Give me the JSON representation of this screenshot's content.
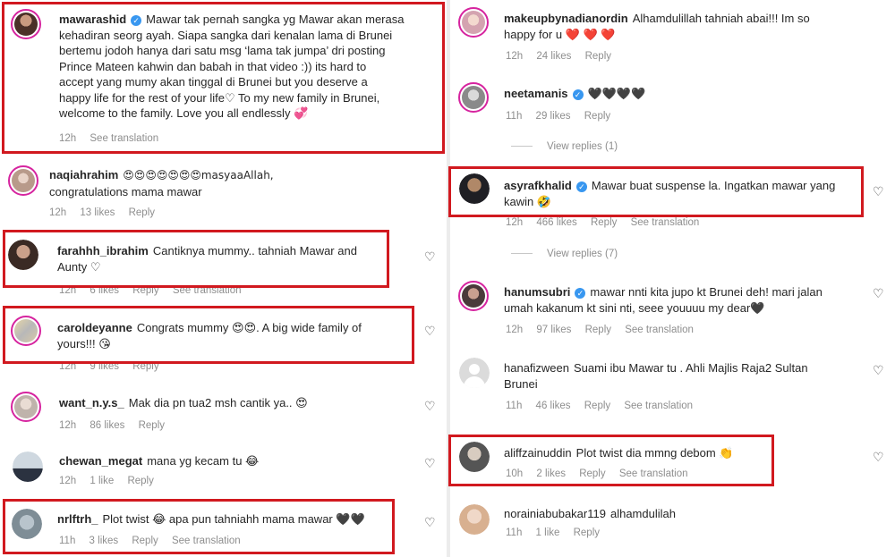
{
  "left": {
    "comments": [
      {
        "username": "mawarashid",
        "verified": true,
        "lines": [
          "Mawar tak pernah sangka yg Mawar akan merasa",
          "kehadiran seorg ayah. Siapa sangka dari kenalan lama di Brunei",
          "bertemu jodoh hanya dari satu msg ‘lama tak jumpa’ dri posting",
          "Prince Mateen kahwin dan babah in that video :)) its hard to",
          "accept yang mumy akan tinggal di Brunei but you deserve a",
          "happy life for the rest of your life♡  To my new family in Brunei,",
          "welcome to the family. Love you all endlessly 💞"
        ],
        "time": "12h",
        "likes": "",
        "reply": "",
        "translation": "See translation"
      },
      {
        "username": "naqiahrahim",
        "verified": false,
        "lines": [
          "😍😍😍😍😍😍😍masyaaAllah,",
          "congratulations mama mawar"
        ],
        "time": "12h",
        "likes": "13 likes",
        "reply": "Reply",
        "translation": ""
      },
      {
        "username": "farahhh_ibrahim",
        "verified": false,
        "lines": [
          "Cantiknya mummy.. tahniah Mawar and",
          "Aunty ♡"
        ],
        "time": "12h",
        "likes": "6 likes",
        "reply": "Reply",
        "translation": "See translation"
      },
      {
        "username": "caroldeyanne",
        "verified": false,
        "lines": [
          "Congrats mummy 😍😍. A big wide family of",
          "yours!!! 😘"
        ],
        "time": "12h",
        "likes": "9 likes",
        "reply": "Reply",
        "translation": ""
      },
      {
        "username": "want_n.y.s_",
        "verified": false,
        "lines": [
          "Mak dia pn tua2 msh cantik ya.. 😍"
        ],
        "time": "12h",
        "likes": "86 likes",
        "reply": "Reply",
        "translation": ""
      },
      {
        "username": "chewan_megat",
        "verified": false,
        "lines": [
          "mana yg kecam tu 😂"
        ],
        "time": "12h",
        "likes": "1 like",
        "reply": "Reply",
        "translation": ""
      },
      {
        "username": "nrlftrh_",
        "verified": false,
        "lines": [
          "Plot twist 😂 apa pun tahniahh mama mawar 🖤🖤"
        ],
        "time": "11h",
        "likes": "3 likes",
        "reply": "Reply",
        "translation": "See translation"
      }
    ]
  },
  "right": {
    "comments": [
      {
        "username": "makeupbynadianordin",
        "verified": false,
        "lines": [
          "Alhamdulillah tahniah abai!!! Im so",
          "happy for u ❤️ ❤️ ❤️"
        ],
        "time": "12h",
        "likes": "24 likes",
        "reply": "Reply",
        "translation": ""
      },
      {
        "username": "neetamanis",
        "verified": true,
        "lines": [
          "🖤🖤🖤🖤"
        ],
        "time": "11h",
        "likes": "29 likes",
        "reply": "Reply",
        "translation": ""
      },
      {
        "username": "asyrafkhalid",
        "verified": true,
        "lines": [
          "Mawar buat suspense la. Ingatkan mawar yang",
          "kawin 🤣"
        ],
        "time": "12h",
        "likes": "466 likes",
        "reply": "Reply",
        "translation": "See translation"
      },
      {
        "username": "hanumsubri",
        "verified": true,
        "lines": [
          "mawar nnti kita jupo kt Brunei deh! mari jalan",
          "umah kakanum kt sini nti, seee youuuu my dear🖤"
        ],
        "time": "12h",
        "likes": "97 likes",
        "reply": "Reply",
        "translation": "See translation"
      },
      {
        "username": "hanafizween",
        "verified": false,
        "lines": [
          "Suami ibu Mawar tu . Ahli Majlis Raja2 Sultan",
          "Brunei"
        ],
        "time": "11h",
        "likes": "46 likes",
        "reply": "Reply",
        "translation": "See translation"
      },
      {
        "username": "aliffzainuddin",
        "verified": false,
        "lines": [
          "Plot twist dia mmng debom 👏"
        ],
        "time": "10h",
        "likes": "2 likes",
        "reply": "Reply",
        "translation": "See translation"
      },
      {
        "username": "norainiabubakar119",
        "verified": false,
        "lines": [
          "alhamdulilah"
        ],
        "time": "11h",
        "likes": "1 like",
        "reply": "Reply",
        "translation": ""
      }
    ],
    "view_replies": [
      "View replies (1)",
      "View replies (7)"
    ]
  },
  "icons": {
    "like": "heart-outline-icon",
    "verified": "verified-badge-icon"
  },
  "colors": {
    "highlight": "#d1191f",
    "verified": "#3897f0",
    "meta": "#8e8e8e",
    "story_ring": "#d6249f"
  }
}
